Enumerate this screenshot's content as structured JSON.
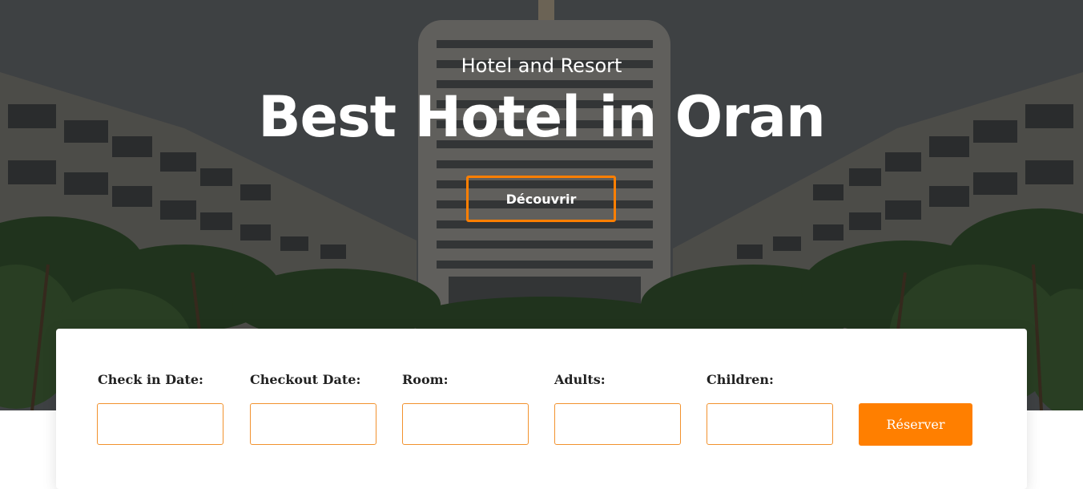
{
  "hero": {
    "subtitle": "Hotel and Resort",
    "title": "Best Hotel in Oran",
    "discover_label": "Découvrir"
  },
  "booking": {
    "fields": [
      {
        "label": "Check in Date:",
        "value": ""
      },
      {
        "label": "Checkout Date:",
        "value": ""
      },
      {
        "label": "Room:",
        "value": ""
      },
      {
        "label": "Adults:",
        "value": ""
      },
      {
        "label": "Children:",
        "value": ""
      }
    ],
    "reserve_label": "Réserver"
  },
  "colors": {
    "accent": "#ff7f00",
    "input_border": "#f2922e",
    "label_text": "#222222"
  }
}
